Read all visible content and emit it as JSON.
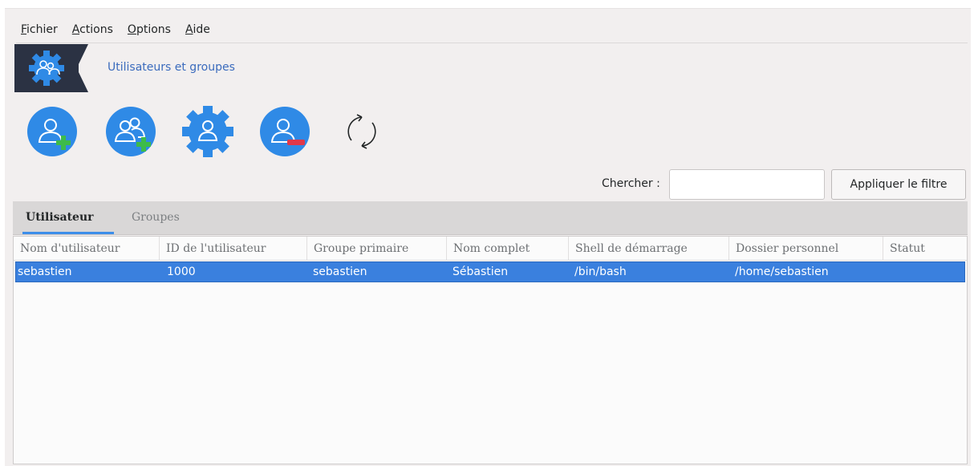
{
  "menu": {
    "items": [
      {
        "mnemonic": "F",
        "rest": "ichier"
      },
      {
        "mnemonic": "A",
        "rest": "ctions"
      },
      {
        "mnemonic": "O",
        "rest": "ptions"
      },
      {
        "mnemonic": "A",
        "rest": "ide"
      }
    ]
  },
  "header": {
    "title": "Utilisateurs et groupes"
  },
  "toolbar": {
    "icons": [
      "add-user-icon",
      "add-group-icon",
      "edit-settings-icon",
      "delete-user-icon",
      "refresh-icon"
    ],
    "accent": "#2f8ae6",
    "plus_color": "#3dbb4a",
    "minus_color": "#e0384a"
  },
  "search": {
    "label": "Chercher :",
    "value": "",
    "placeholder": ""
  },
  "filter": {
    "label": "Appliquer le filtre"
  },
  "tabs": [
    {
      "label": "Utilisateur",
      "active": true
    },
    {
      "label": "Groupes",
      "active": false
    }
  ],
  "table": {
    "columns": [
      "Nom d'utilisateur",
      "ID de l'utilisateur",
      "Groupe primaire",
      "Nom complet",
      "Shell de démarrage",
      "Dossier personnel",
      "Statut"
    ],
    "rows": [
      [
        "sebastien",
        "1000",
        "sebastien",
        "Sébastien",
        "/bin/bash",
        "/home/sebastien",
        ""
      ]
    ],
    "selected_row": 0,
    "selection_color": "#3a80de"
  }
}
